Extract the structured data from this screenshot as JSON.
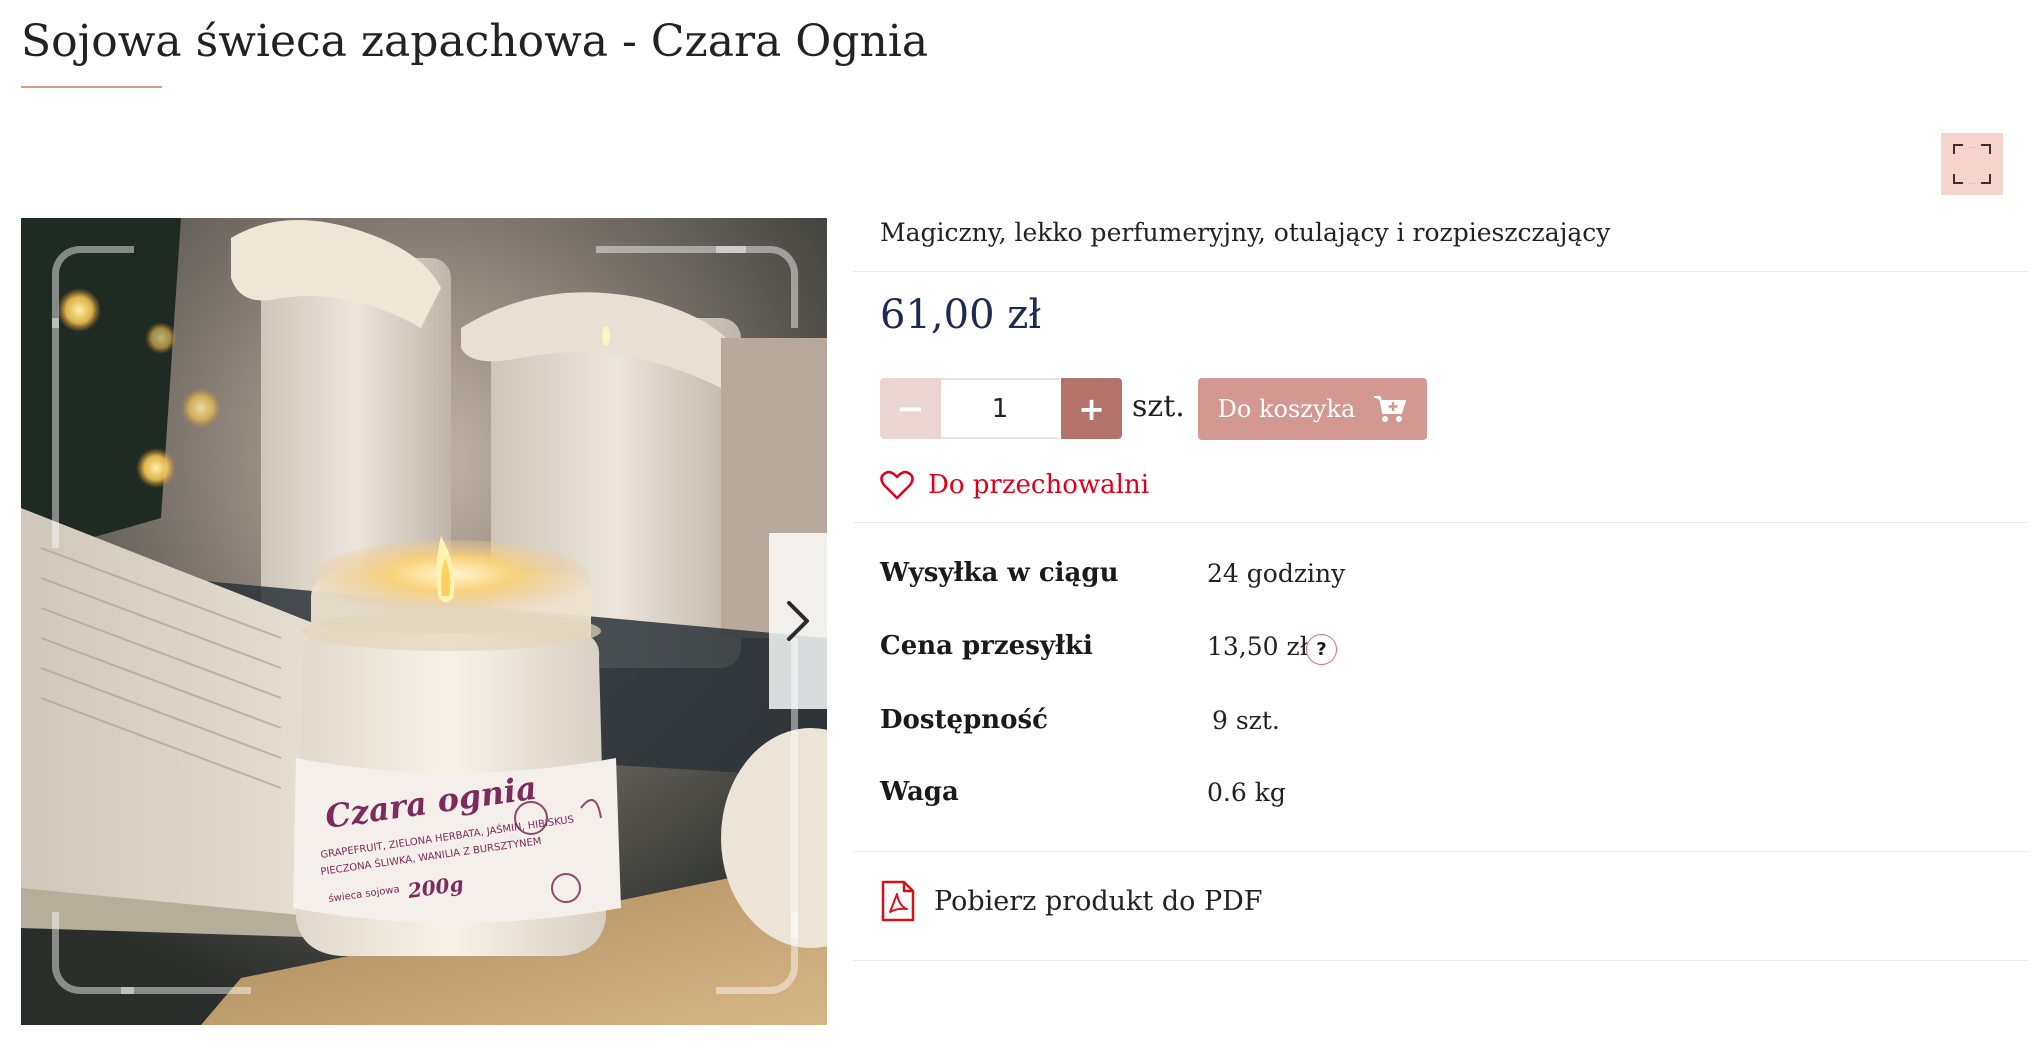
{
  "product": {
    "title": "Sojowa świeca zapachowa - Czara Ognia",
    "short_description": "Magiczny, lekko perfumeryjny, otulający i rozpieszczający",
    "price": "61,00 zł",
    "image": {
      "label_title": "Czara ognia",
      "label_notes_1": "GRAPEFRUIT, ZIELONA HERBATA, JAŚMIN, HIBISKUS",
      "label_notes_2": "PIECZONA ŚLIWKA, WANILIA Z BURSZTYNEM",
      "label_type": "świeca sojowa",
      "label_weight": "200g"
    }
  },
  "cart": {
    "minus_symbol": "−",
    "plus_symbol": "+",
    "quantity": "1",
    "unit": "szt.",
    "add_to_cart_label": "Do koszyka"
  },
  "wishlist": {
    "label": "Do przechowalni"
  },
  "details": [
    {
      "label": "Wysyłka w ciągu",
      "value": "24 godziny"
    },
    {
      "label": "Cena przesyłki",
      "value": "13,50 zł",
      "help": "?"
    },
    {
      "label": "Dostępność",
      "value": "9 szt."
    },
    {
      "label": "Waga",
      "value": "0.6 kg"
    }
  ],
  "pdf": {
    "label": "Pobierz produkt do PDF"
  },
  "icons": {
    "next": "chevron-right-icon",
    "cart": "cart-plus-icon",
    "wishlist": "heart-icon",
    "pdf": "pdf-icon",
    "brand": "brand-logo"
  },
  "colors": {
    "price": "#1e2a50",
    "accent": "#d39892",
    "qty_plus": "#b4736a",
    "qty_minus": "#ead5d2",
    "wishlist": "#e1001a",
    "title_underline": "#d89a8c",
    "brand_bg": "#f6d3cc"
  }
}
